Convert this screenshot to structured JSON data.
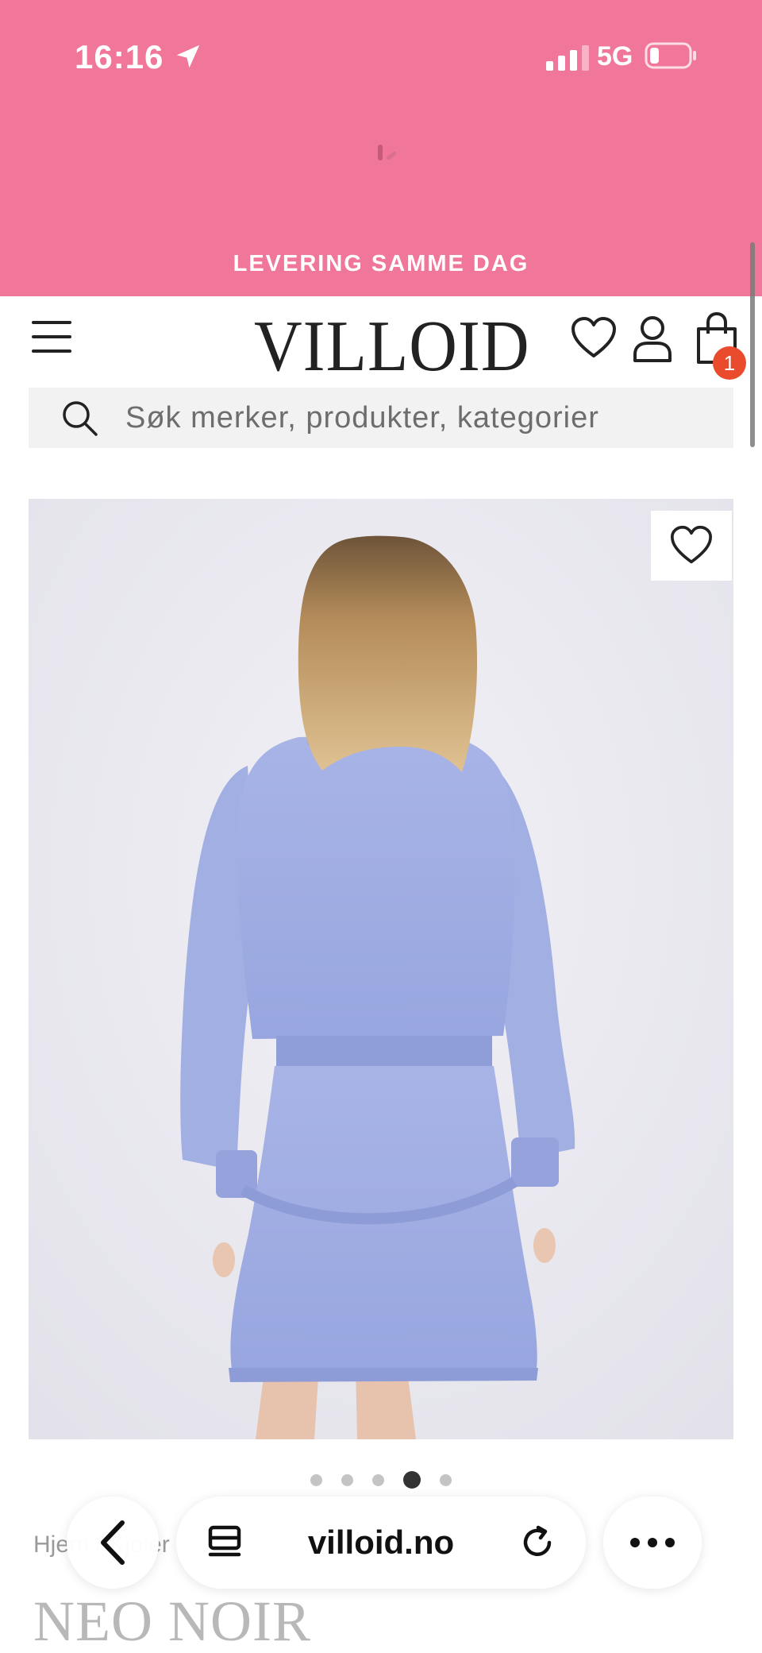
{
  "status_bar": {
    "time": "16:16",
    "network": "5G",
    "icons": [
      "location-arrow-icon",
      "cellular-signal-icon",
      "battery-low-icon"
    ]
  },
  "promo": {
    "text": "LEVERING SAMME DAG",
    "background_color": "#f07799"
  },
  "header": {
    "logo": "VILLOID",
    "icons": [
      "menu-icon",
      "heart-icon",
      "user-icon",
      "shopping-bag-icon"
    ],
    "cart_count": "1",
    "badge_color": "#ea4b2d"
  },
  "search": {
    "placeholder": "Søk merker, produkter, kategorier"
  },
  "product": {
    "image_dots_total": 5,
    "image_dots_active_index": 3,
    "breadcrumb": "Hjem / Kjoler",
    "brand": "NEO NOIR"
  },
  "browser": {
    "url": "villoid.no",
    "icons": [
      "chevron-left-icon",
      "tab-list-icon",
      "reload-icon",
      "more-icon"
    ]
  }
}
